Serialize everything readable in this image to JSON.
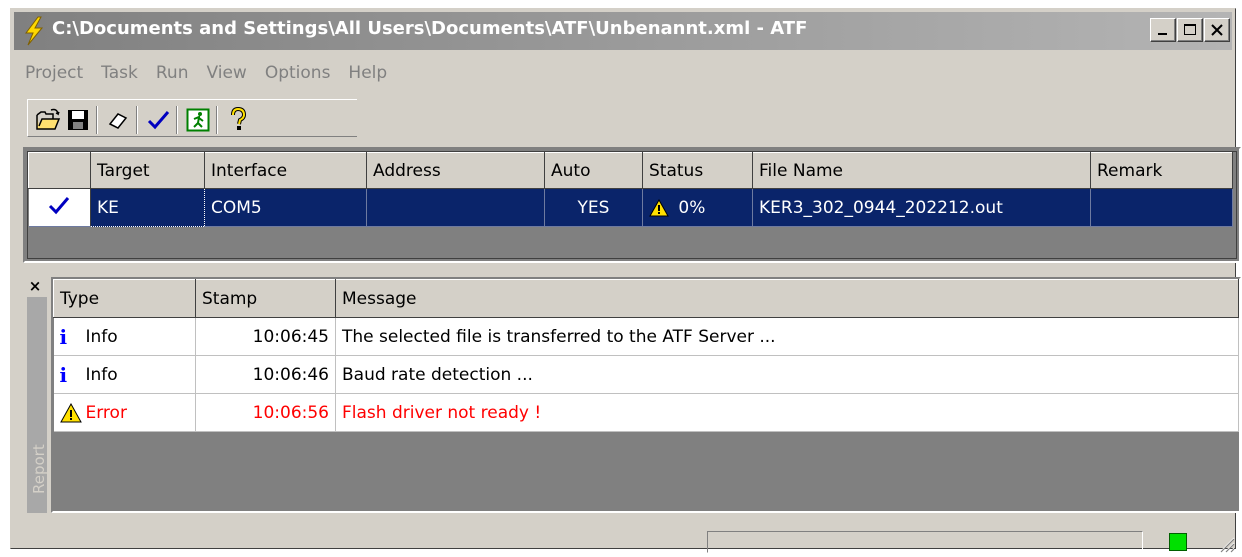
{
  "window": {
    "title": "C:\\Documents and Settings\\All Users\\Documents\\ATF\\Unbenannt.xml - ATF",
    "controls": [
      "minimize-icon",
      "maximize-icon",
      "close-icon"
    ]
  },
  "menu": {
    "items": [
      {
        "label": "Project"
      },
      {
        "label": "Task"
      },
      {
        "label": "Run"
      },
      {
        "label": "View"
      },
      {
        "label": "Options"
      },
      {
        "label": "Help"
      }
    ]
  },
  "toolbar": {
    "icons": [
      "open-folder-icon",
      "save-icon",
      "eraser-icon",
      "checkmark-icon",
      "run-icon",
      "help-icon"
    ]
  },
  "targets": {
    "columns": [
      "Target",
      "Interface",
      "Address",
      "Auto",
      "Status",
      "File Name",
      "Remark"
    ],
    "rows": [
      {
        "checked": true,
        "target": "KE",
        "interface": "COM5",
        "address": "",
        "auto": "YES",
        "status": "0%",
        "status_icon": "warning-icon",
        "file_name": "KER3_302_0944_202212.out",
        "remark": ""
      }
    ]
  },
  "report": {
    "tab_label": "Report",
    "close_label": "×",
    "columns": [
      "Type",
      "Stamp",
      "Message"
    ],
    "rows": [
      {
        "type": "Info",
        "icon": "info-icon",
        "stamp": "10:06:45",
        "message": "The selected file is transferred to the ATF Server ..."
      },
      {
        "type": "Info",
        "icon": "info-icon",
        "stamp": "10:06:46",
        "message": "Baud rate detection ..."
      },
      {
        "type": "Error",
        "icon": "warning-icon",
        "stamp": "10:06:56",
        "message": "Flash driver not ready !"
      }
    ]
  },
  "statusbar": {
    "progress": 0,
    "led_color": "#00e000"
  },
  "colors": {
    "selection": "#0a246a",
    "error": "#ff0000",
    "info": "#0000ff"
  }
}
